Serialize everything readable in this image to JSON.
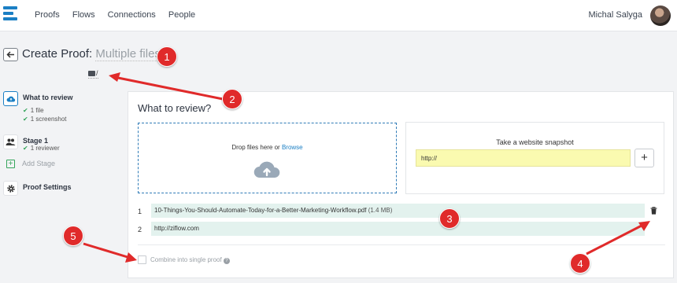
{
  "nav": {
    "items": [
      "Proofs",
      "Flows",
      "Connections",
      "People"
    ],
    "user_name": "Michal Salyga"
  },
  "header": {
    "title_prefix": "Create Proof:",
    "title_placeholder": "Multiple files",
    "folder_path": "/"
  },
  "sidebar": {
    "what_to_review": {
      "label": "What to review",
      "sub": [
        "1 file",
        "1 screenshot"
      ]
    },
    "stage": {
      "label": "Stage 1",
      "sub": "1 reviewer"
    },
    "add_stage": "Add Stage",
    "proof_settings": "Proof Settings"
  },
  "main": {
    "title": "What to review?",
    "drop_text": "Drop files here or ",
    "browse_link": "Browse",
    "snapshot_title": "Take a website snapshot",
    "url_value": "http://",
    "add_button": "+",
    "files": [
      {
        "num": "1",
        "name": "10-Things-You-Should-Automate-Today-for-a-Better-Marketing-Workflow.pdf",
        "size": "(1.4 MB)"
      },
      {
        "num": "2",
        "name": "http://ziflow.com",
        "size": ""
      }
    ],
    "combine_label": "Combine into single proof",
    "help": "?"
  },
  "callouts": [
    "1",
    "2",
    "3",
    "4",
    "5"
  ],
  "colors": {
    "accent": "#1b7fc4",
    "callout": "#e02a2a",
    "row_bg": "#e3f2ee",
    "url_bg": "#fafab0",
    "check": "#35a55b"
  }
}
